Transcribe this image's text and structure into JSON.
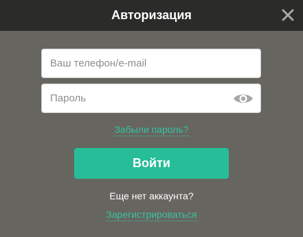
{
  "modal": {
    "title": "Авторизация",
    "close_icon": "close-icon"
  },
  "form": {
    "login_placeholder": "Ваш телефон/e-mail",
    "login_value": "",
    "password_placeholder": "Пароль",
    "password_value": "",
    "password_toggle_icon": "eye-icon",
    "forgot_label": "Забыли пароль?",
    "submit_label": "Войти",
    "no_account_text": "Еще нет аккаунта?",
    "register_label": "Зарегистрироваться"
  },
  "colors": {
    "header_background": "#2b2b2a",
    "modal_background": "#676560",
    "accent": "#26bd98",
    "link": "#36c3a1",
    "icon": "#a8a8a8"
  }
}
